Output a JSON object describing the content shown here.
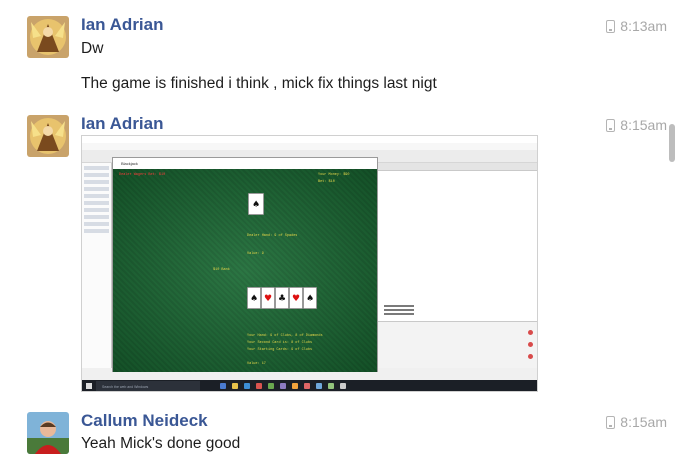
{
  "messages": [
    {
      "author": "Ian Adrian",
      "time": "8:13am",
      "lines": [
        "Dw",
        "The game is finished i think , mick fix things last nigt"
      ]
    },
    {
      "author": "Ian Adrian",
      "time": "8:15am",
      "attachment": {
        "type": "screenshot",
        "window_title": "Blackjack",
        "taskbar_search": "Search the web and Windows",
        "game_texts": {
          "top_left": "Dealer Wagers Bet: $10",
          "top_right_1": "Your Money: $90",
          "top_right_2": "Bet: $10",
          "mid_1": "Dealer Hand: 9 of Spades",
          "mid_2": "Value: 9",
          "mid_left": "$10 Bank",
          "bottom_1": "Your Hand: 9 of Clubs, 8 of Diamonds",
          "bottom_2": "Your Second Card is: 8 of Clubs",
          "bottom_3": "Your Starting Cards: 9 of Clubs",
          "bottom_4": "Value: 17"
        },
        "cards": {
          "dealer": [
            "♠"
          ],
          "player": [
            "♠",
            "♥",
            "♣",
            "♥",
            "♠"
          ]
        }
      }
    },
    {
      "author": "Callum Neideck",
      "time": "8:15am",
      "lines": [
        "Yeah Mick's done good"
      ]
    }
  ],
  "icons": {
    "time_marker": "phone-icon"
  }
}
